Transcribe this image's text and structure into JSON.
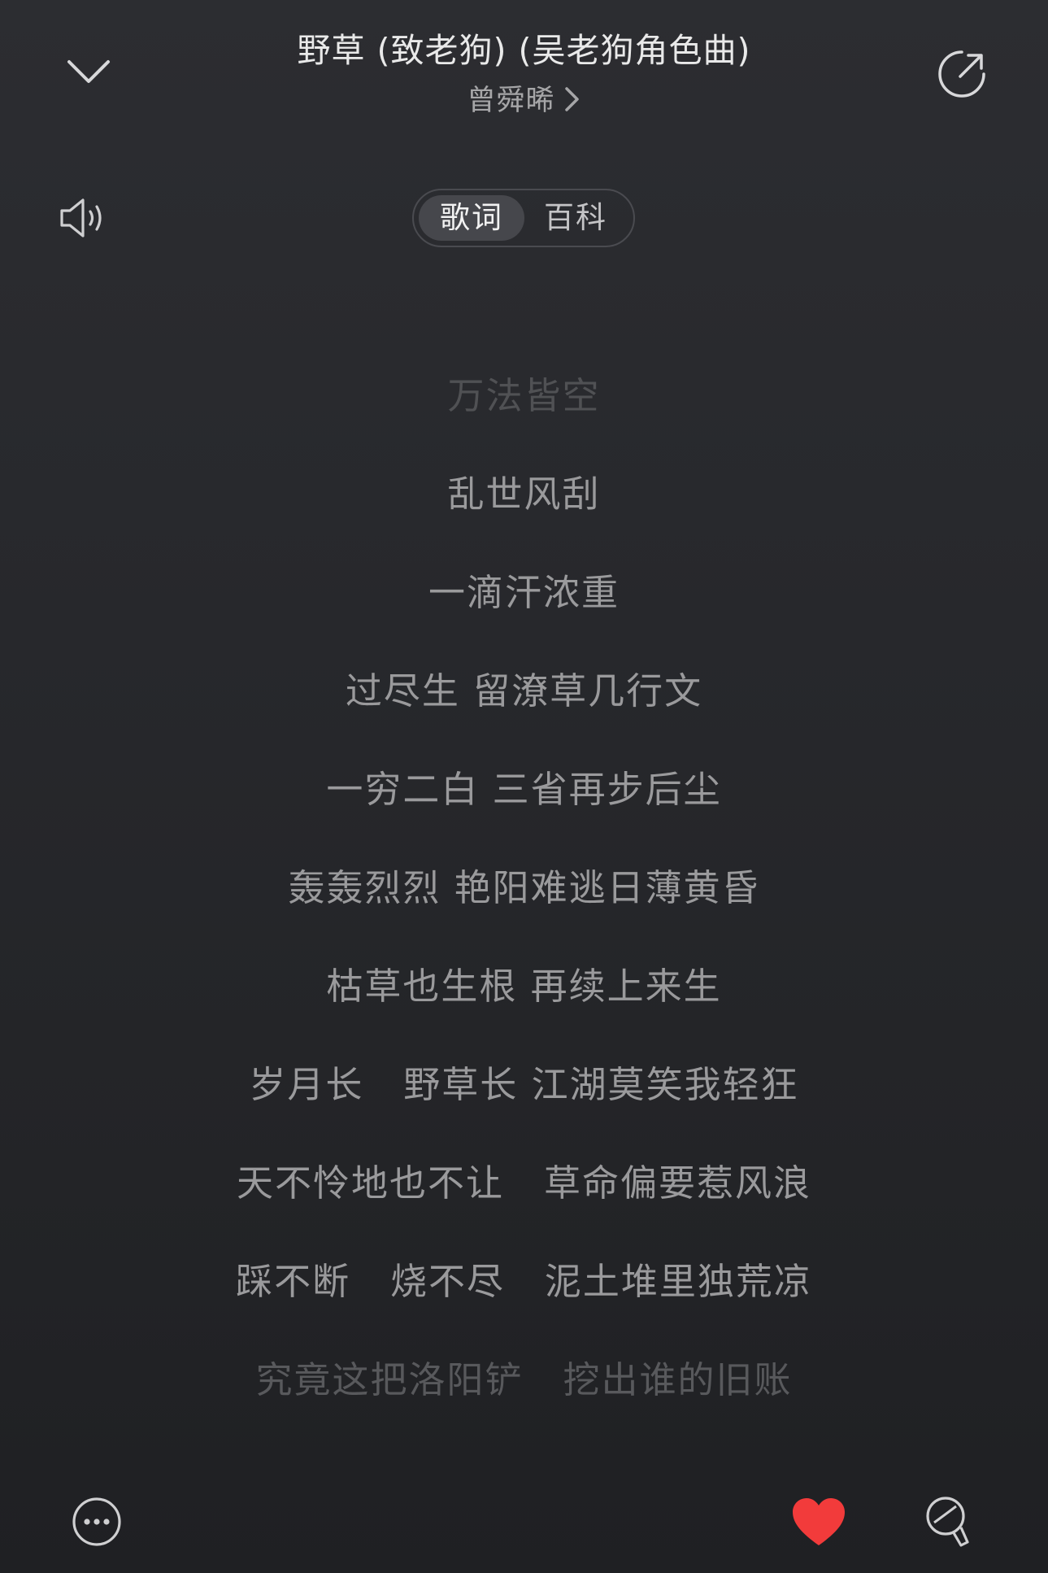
{
  "header": {
    "title": "野草 (致老狗) (吴老狗角色曲)",
    "artist": "曾舜晞",
    "collapse_icon": "chevron-down-icon",
    "artist_arrow_icon": "chevron-right-icon",
    "share_icon": "share-icon"
  },
  "volume_icon": "speaker-icon",
  "tabs": [
    {
      "label": "歌词",
      "active": true
    },
    {
      "label": "百科",
      "active": false
    }
  ],
  "lyrics": [
    "万法皆空",
    "乱世风刮",
    "一滴汗浓重",
    "过尽生 留潦草几行文",
    "一穷二白 三省再步后尘",
    "轰轰烈烈 艳阳难逃日薄黄昏",
    "枯草也生根 再续上来生",
    "岁月长   野草长 江湖莫笑我轻狂",
    "天不怜地也不让   草命偏要惹风浪",
    "踩不断   烧不尽   泥土堆里独荒凉",
    "究竟这把洛阳铲   挖出谁的旧账"
  ],
  "bottom_bar": {
    "more_icon": "more-icon",
    "like_icon": "heart-icon",
    "like_color": "#f23b3b",
    "comment_icon": "comment-icon"
  }
}
